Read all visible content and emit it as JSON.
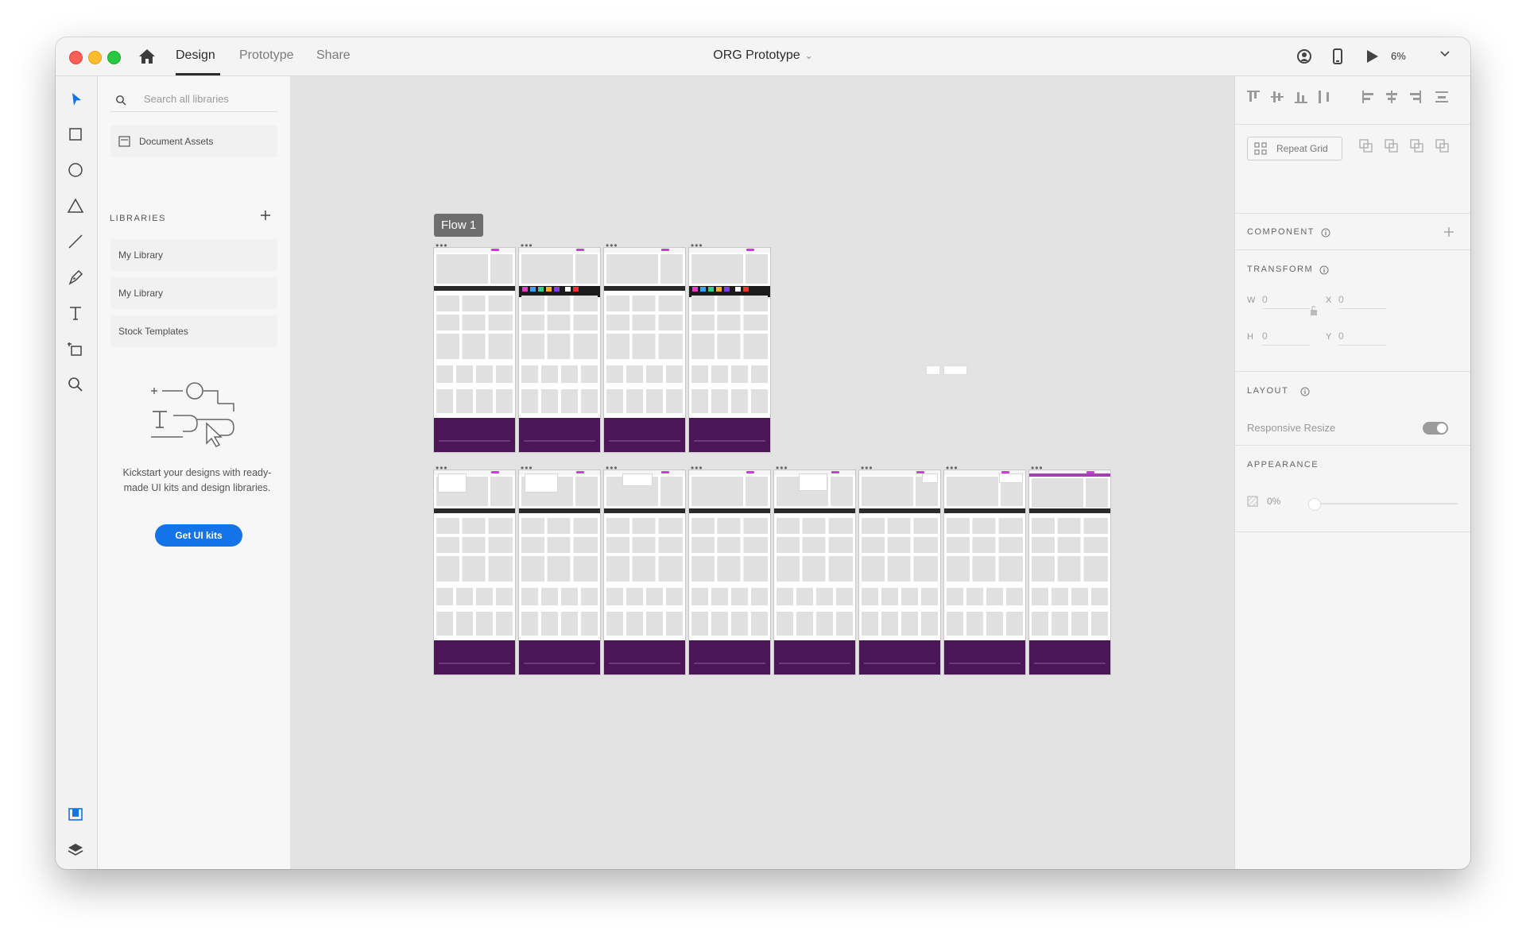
{
  "titlebar": {
    "tabs": [
      {
        "label": "Design",
        "active": true
      },
      {
        "label": "Prototype",
        "active": false
      },
      {
        "label": "Share",
        "active": false
      }
    ],
    "document_title": "ORG Prototype",
    "zoom": "6%"
  },
  "left_panel": {
    "search_placeholder": "Search all libraries",
    "document_assets": "Document Assets",
    "libraries_heading": "LIBRARIES",
    "libraries": [
      {
        "label": "My Library"
      },
      {
        "label": "My Library"
      },
      {
        "label": "Stock Templates"
      }
    ],
    "kickstart_text": "Kickstart your designs with ready-made UI kits and design libraries.",
    "get_ui_kits": "Get UI kits"
  },
  "canvas": {
    "flow_label": "Flow 1",
    "artboard_menu_glyph": "•••",
    "row1_artboards": 4,
    "row2_artboards": 8
  },
  "right_panel": {
    "repeat_grid": "Repeat Grid",
    "component_heading": "COMPONENT",
    "transform_heading": "TRANSFORM",
    "w_label": "W",
    "w_value": "0",
    "x_label": "X",
    "x_value": "0",
    "h_label": "H",
    "h_value": "0",
    "y_label": "Y",
    "y_value": "0",
    "layout_heading": "LAYOUT",
    "responsive_resize": "Responsive Resize",
    "responsive_resize_on": true,
    "appearance_heading": "APPEARANCE",
    "opacity": "0%"
  },
  "colors": {
    "accent_blue": "#1473e6",
    "footer_purple": "#4a1658",
    "brand_magenta": "#c340d0"
  }
}
